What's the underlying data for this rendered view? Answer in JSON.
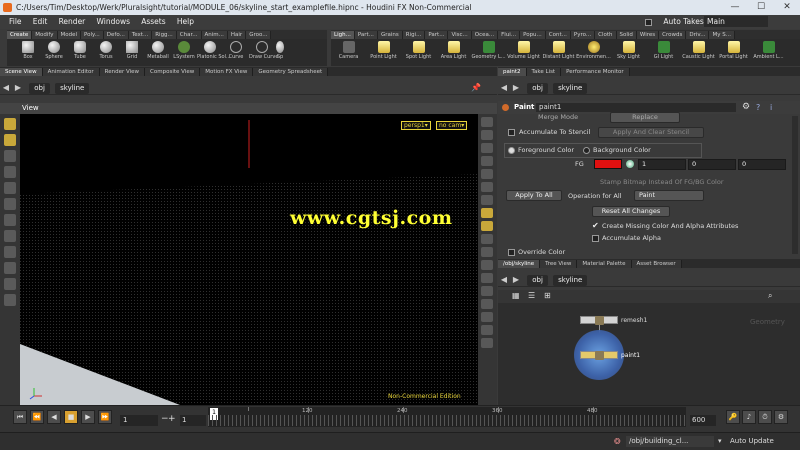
{
  "window": {
    "title": "C:/Users/Tim/Desktop/Werk/Pluralsight/tutorial/MODULE_06/skyline_start_examplefile.hipnc - Houdini FX Non-Commercial",
    "minimize": "—",
    "maximize": "☐",
    "close": "✕"
  },
  "menu": {
    "items": [
      "File",
      "Edit",
      "Render",
      "Windows",
      "Assets",
      "Help"
    ],
    "auto_takes": "Auto Takes",
    "desktop": "Main"
  },
  "shelf_left": {
    "tabs": [
      "Create",
      "Modify",
      "Model",
      "Poly...",
      "Defo...",
      "Text...",
      "Rigg...",
      "Char...",
      "Anim...",
      "Hair",
      "Groo..."
    ],
    "tools": [
      "Box",
      "Sphere",
      "Tube",
      "Torus",
      "Grid",
      "Metaball",
      "LSystem",
      "Platonic Sol...",
      "Curve",
      "Draw Curve",
      "Sp"
    ]
  },
  "shelf_right": {
    "tabs": [
      "Ligh...",
      "Part...",
      "Grains",
      "Rigi...",
      "Part...",
      "Visc...",
      "Ocea...",
      "Flui...",
      "Popu...",
      "Cont...",
      "Pyro...",
      "Cloth",
      "Solid",
      "Wires",
      "Crowds",
      "Driv...",
      "My S..."
    ],
    "tools": [
      "Camera",
      "Point Light",
      "Spot Light",
      "Area Light",
      "Geometry L...",
      "Volume Light",
      "Distant Light",
      "Environmen...",
      "Sky Light",
      "GI Light",
      "Caustic Light",
      "Portal Light",
      "Ambient L..."
    ]
  },
  "left_panel": {
    "tabs": [
      "Scene View",
      "Animation Editor",
      "Render View",
      "Composite View",
      "Motion FX View",
      "Geometry Spreadsheet"
    ],
    "path": [
      "obj",
      "skyline"
    ],
    "view_title": "View",
    "camera": "persp1▾",
    "cam_sel": "no cam▾",
    "non_commercial": "Non-Commercial Edition"
  },
  "watermark": "www.cgtsj.com",
  "param_panel": {
    "tabs": [
      "paint2",
      "Take List",
      "Performance Monitor"
    ],
    "path": [
      "obj",
      "skyline"
    ],
    "node_type": "Paint",
    "node_name": "paint1",
    "merge_mode_label": "Merge Mode",
    "merge_mode_value": "Replace",
    "accumulate_stencil": "Accumulate To Stencil",
    "apply_clear_stencil": "Apply And Clear Stencil",
    "foreground_color": "Foreground Color",
    "background_color": "Background Color",
    "fg_label": "FG",
    "fg_color": "#e01010",
    "fg_values": [
      "1",
      "0",
      "0"
    ],
    "stamp_bitmap": "Stamp Bitmap Instead Of FG/BG Color",
    "apply_to_all": "Apply To All",
    "operation_label": "Operation for All",
    "operation_value": "Paint",
    "reset_all": "Reset All Changes",
    "create_missing": "Create Missing Color And Alpha Attributes",
    "accumulate_alpha": "Accumulate Alpha",
    "override_color": "Override Color"
  },
  "network_panel": {
    "tabs": [
      "/obj/skyline",
      "Tree View",
      "Material Palette",
      "Asset Browser"
    ],
    "path": [
      "obj",
      "skyline"
    ],
    "nodes": [
      {
        "name": "remesh1"
      },
      {
        "name": "paint1"
      }
    ],
    "context": "Geometry"
  },
  "playbar": {
    "start": "1",
    "current": "1",
    "frame": "1",
    "end": "600",
    "ticks": [
      "120",
      "240",
      "360",
      "480"
    ],
    "last_tick": "600"
  },
  "statusbar": {
    "path": "/obj/building_cl...",
    "auto_update": "Auto Update"
  }
}
